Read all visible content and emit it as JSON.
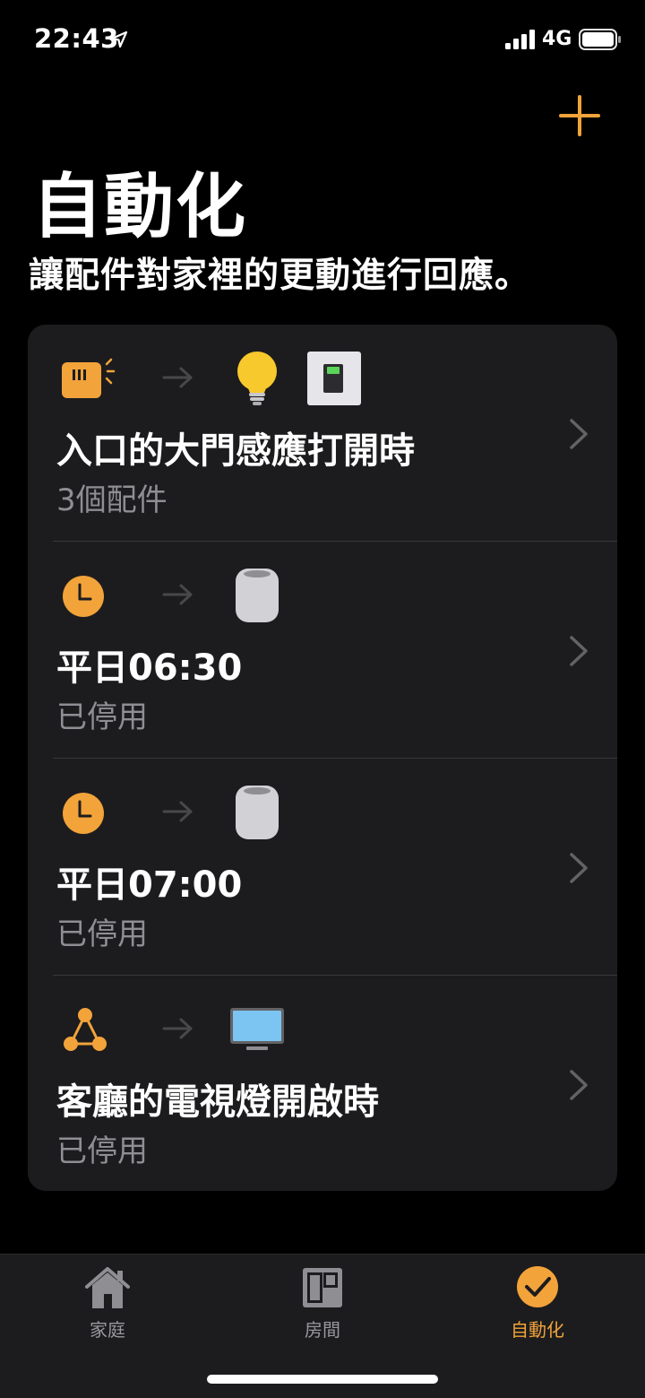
{
  "status_bar": {
    "time": "22:43",
    "network": "4G"
  },
  "colors": {
    "accent": "#f2a33a",
    "card_bg": "#1c1c1e",
    "secondary_text": "#8e8e93"
  },
  "header": {
    "title": "自動化",
    "subtitle": "讓配件對家裡的更動進行回應。"
  },
  "automations": [
    {
      "title": "入口的大門感應打開時",
      "subtitle": "3個配件",
      "trigger_icon": "door-sensor-icon",
      "accessory_icons": [
        "lightbulb-icon",
        "light-switch-icon"
      ]
    },
    {
      "title": "平日06:30",
      "subtitle": "已停用",
      "trigger_icon": "clock-icon",
      "accessory_icons": [
        "homepod-icon"
      ]
    },
    {
      "title": "平日07:00",
      "subtitle": "已停用",
      "trigger_icon": "clock-icon",
      "accessory_icons": [
        "homepod-icon"
      ]
    },
    {
      "title": "客廳的電視燈開啟時",
      "subtitle": "已停用",
      "trigger_icon": "accessory-trigger-icon",
      "accessory_icons": [
        "tv-icon"
      ]
    }
  ],
  "tabs": [
    {
      "label": "家庭",
      "icon": "house-icon",
      "active": false
    },
    {
      "label": "房間",
      "icon": "rooms-icon",
      "active": false
    },
    {
      "label": "自動化",
      "icon": "automation-icon",
      "active": true
    }
  ]
}
